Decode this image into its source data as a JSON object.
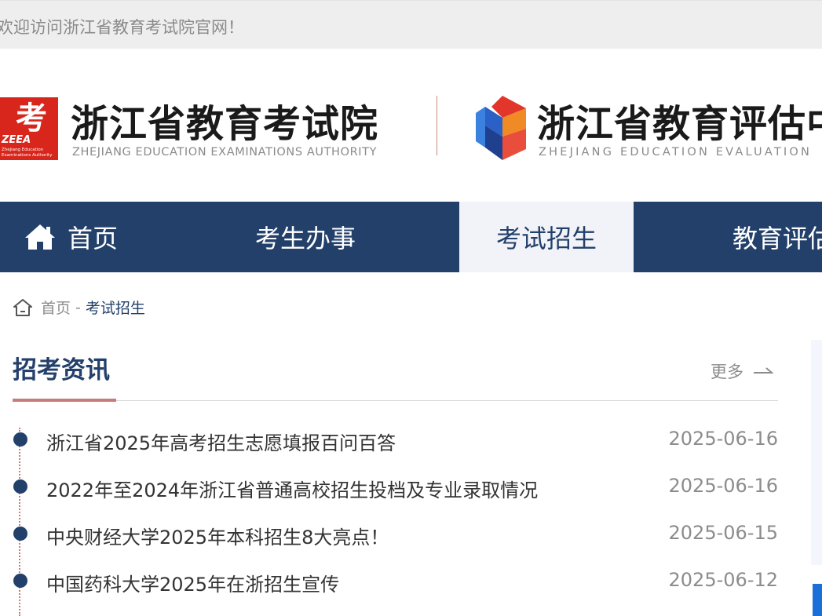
{
  "topbar": {
    "welcome": "欢迎访问浙江省教育考试院官网！"
  },
  "header": {
    "logo1": {
      "mark_text": "考",
      "mark_badge": "ZEEA",
      "mark_sub1": "Zhejiang Education",
      "mark_sub2": "Examinations Authority",
      "cn": "浙江省教育考试院",
      "en": "ZHEJIANG EDUCATION EXAMINATIONS AUTHORITY"
    },
    "logo2": {
      "cn": "浙江省教育评估中",
      "en": "ZHEJIANG EDUCATION EVALUATION"
    }
  },
  "nav": {
    "items": [
      {
        "label": "首页",
        "icon": "home-icon"
      },
      {
        "label": "考生办事"
      },
      {
        "label": "考试招生",
        "active": true
      },
      {
        "label": "教育评估"
      }
    ]
  },
  "breadcrumb": {
    "home": "首页",
    "separator": "-",
    "current": "考试招生"
  },
  "section": {
    "title": "招考资讯",
    "more": "更多",
    "news": [
      {
        "title": "浙江省2025年高考招生志愿填报百问百答",
        "date": "2025-06-16"
      },
      {
        "title": "2022年至2024年浙江省普通高校招生投档及专业录取情况",
        "date": "2025-06-16"
      },
      {
        "title": "中央财经大学2025年本科招生8大亮点！",
        "date": "2025-06-15"
      },
      {
        "title": "中国药科大学2025年在浙招生宣传",
        "date": "2025-06-12"
      }
    ]
  },
  "colors": {
    "nav_bg": "#23406b",
    "accent": "#c97b7b",
    "active_bg": "#f2f3f8",
    "logo_red": "#d9261c"
  }
}
